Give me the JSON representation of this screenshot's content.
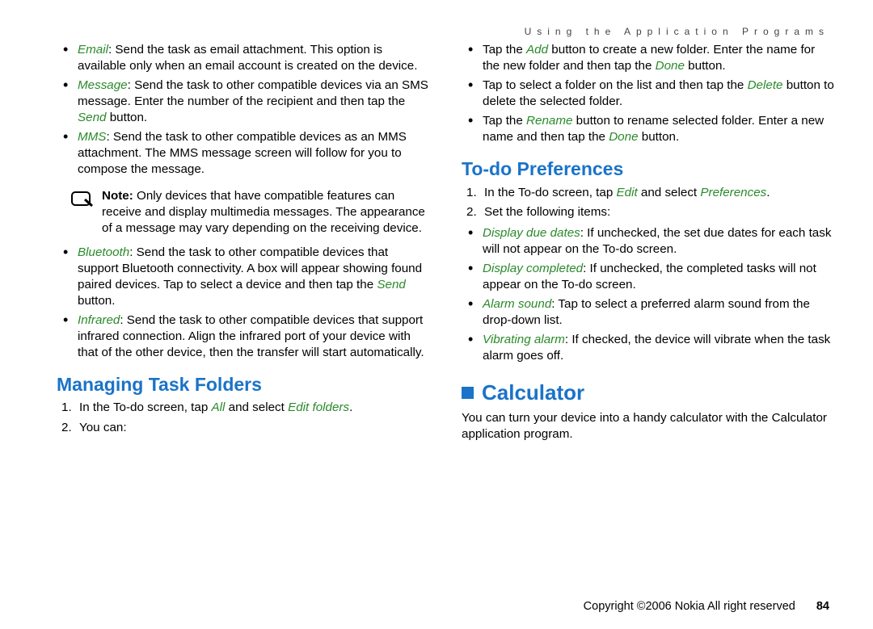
{
  "header": "Using the Application Programs",
  "left": {
    "bullets1": [
      {
        "term": "Email",
        "text": ": Send the task as email attachment. This option is available only when an email account is created on the device."
      },
      {
        "term": "Message",
        "text_before": ": Send the task to other compatible devices via an SMS message. Enter the number of the recipient and then tap the ",
        "term2": "Send",
        "text_after": " button."
      },
      {
        "term": "MMS",
        "text": ": Send the task to other compatible devices as an MMS attachment. The MMS message screen will follow for you to compose the message."
      }
    ],
    "note_label": "Note:",
    "note_text": " Only devices that have compatible features can receive and display multimedia messages. The appearance of a message may vary depending on the receiving device.",
    "bullets2": [
      {
        "term": "Bluetooth",
        "text_before": ": Send the task to other compatible devices that support Bluetooth connectivity. A box will appear showing found paired devices. Tap to select a device and then tap the ",
        "term2": "Send",
        "text_after": " button."
      },
      {
        "term": "Infrared",
        "text": ": Send the task to other compatible devices that support infrared connection. Align the infrared port of your device with that of the other device, then the transfer will start automatically."
      }
    ],
    "h2": "Managing Task Folders",
    "ol": [
      {
        "pre": "In the To-do screen, tap ",
        "g1": "All",
        "mid": " and select ",
        "g2": "Edit folders",
        "post": "."
      },
      {
        "text": "You can:"
      }
    ]
  },
  "right": {
    "bullets1": [
      {
        "pre": "Tap the ",
        "g1": "Add",
        "mid": " button to create a new folder. Enter the name for the new folder and then tap the ",
        "g2": "Done",
        "post": " button."
      },
      {
        "pre": " Tap to select a folder on the list and then tap the ",
        "g1": "Delete",
        "post": " button to delete the selected folder."
      },
      {
        "pre": "Tap the ",
        "g1": "Rename",
        "mid": " button to rename selected folder. Enter a new name and then tap the ",
        "g2": "Done",
        "post": " button."
      }
    ],
    "h2": "To-do Preferences",
    "ol": [
      {
        "pre": "In the To-do screen, tap ",
        "g1": "Edit",
        "mid": " and select ",
        "g2": "Preferences",
        "post": "."
      },
      {
        "text": "Set the following items:"
      }
    ],
    "bullets2": [
      {
        "term": "Display due dates",
        "text": ": If unchecked, the set due dates for each task will not appear on the To-do screen."
      },
      {
        "term": "Display completed",
        "text": ": If unchecked, the completed tasks will not appear on the To-do screen."
      },
      {
        "term": "Alarm sound",
        "text": ": Tap to select a preferred alarm sound from the drop-down list."
      },
      {
        "term": "Vibrating alarm",
        "text": ": If checked, the device will vibrate when the task alarm goes off."
      }
    ],
    "h1": "Calculator",
    "calc_text": "You can turn your device into a handy calculator with the Calculator application program."
  },
  "footer": {
    "copyright": "Copyright ©2006 Nokia All right reserved",
    "page": "84"
  }
}
